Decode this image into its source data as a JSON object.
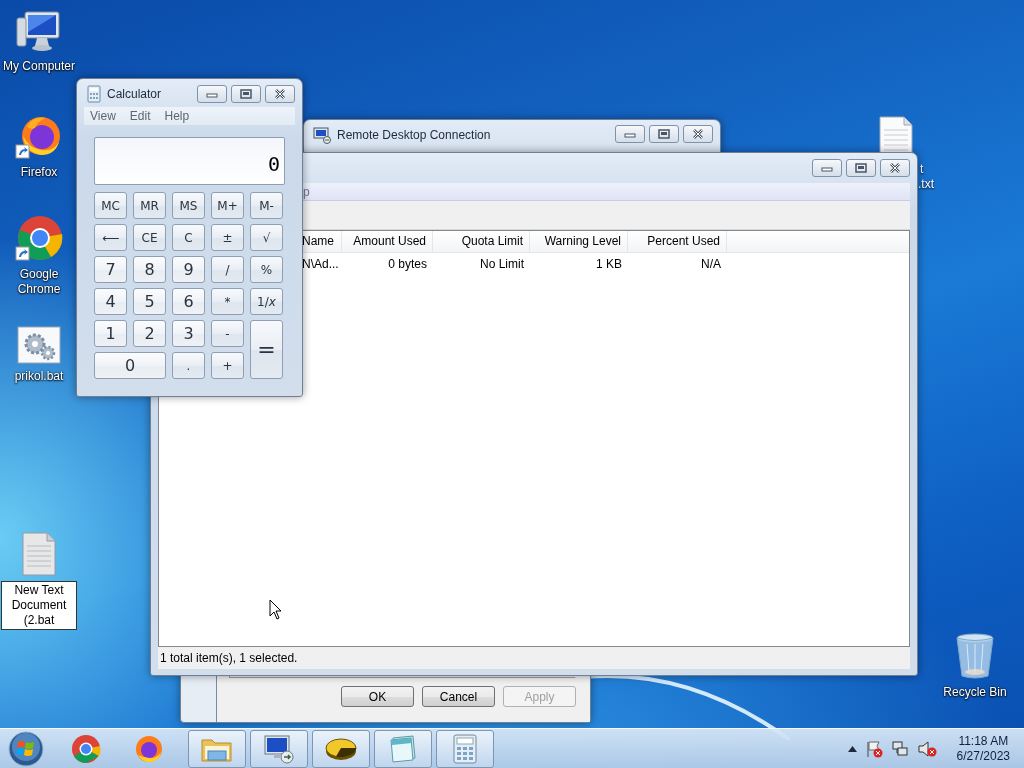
{
  "desktop_icons": [
    {
      "label": "My Computer",
      "kind": "computer",
      "selected": false
    },
    {
      "label": "Firefox",
      "kind": "firefox",
      "selected": false
    },
    {
      "label": "Google Chrome",
      "kind": "chrome",
      "selected": false
    },
    {
      "label": "prikol.bat",
      "kind": "batch",
      "selected": false
    },
    {
      "label": "New Text Document (2.bat",
      "kind": "text",
      "selected": true
    },
    {
      "lines": [
        "t",
        ".txt"
      ],
      "kind": "text"
    },
    {
      "label": "Recycle Bin",
      "kind": "recycle",
      "selected": false
    }
  ],
  "properties_dialog": {
    "buttons": [
      {
        "label": "OK",
        "disabled": false
      },
      {
        "label": "Cancel",
        "disabled": false
      },
      {
        "label": "Apply",
        "disabled": true
      }
    ]
  },
  "remote_desktop_window": {
    "title": "Remote Desktop Connection"
  },
  "quota_window": {
    "menu": [
      "p"
    ],
    "columns": [
      "Name",
      "Amount Used",
      "Quota Limit",
      "Warning Level",
      "Percent Used"
    ],
    "rows": [
      {
        "cells": [
          "N\\Ad...",
          "0 bytes",
          "No Limit",
          "1 KB",
          "N/A"
        ]
      }
    ],
    "status_bar": "1 total item(s), 1 selected."
  },
  "calculator": {
    "title": "Calculator",
    "menu": [
      "View",
      "Edit",
      "Help"
    ],
    "display": "0",
    "keys": [
      {
        "label": "MC",
        "kind": "normal"
      },
      {
        "label": "MR",
        "kind": "normal"
      },
      {
        "label": "MS",
        "kind": "normal"
      },
      {
        "label": "M+",
        "kind": "normal"
      },
      {
        "label": "M-",
        "kind": "normal"
      },
      {
        "label": "⟵",
        "kind": "normal"
      },
      {
        "label": "CE",
        "kind": "normal"
      },
      {
        "label": "C",
        "kind": "normal"
      },
      {
        "label": "±",
        "kind": "normal"
      },
      {
        "label": "√",
        "kind": "normal"
      },
      {
        "label": "7",
        "kind": "normal"
      },
      {
        "label": "8",
        "kind": "normal"
      },
      {
        "label": "9",
        "kind": "normal"
      },
      {
        "label": "/",
        "kind": "normal"
      },
      {
        "label": "%",
        "kind": "normal"
      },
      {
        "label": "4",
        "kind": "normal"
      },
      {
        "label": "5",
        "kind": "normal"
      },
      {
        "label": "6",
        "kind": "normal"
      },
      {
        "label": "*",
        "kind": "normal"
      },
      {
        "label": "1/*x*",
        "kind": "normal"
      },
      {
        "label": "1",
        "kind": "normal"
      },
      {
        "label": "2",
        "kind": "normal"
      },
      {
        "label": "3",
        "kind": "normal"
      },
      {
        "label": "-",
        "kind": "normal"
      },
      {
        "label": "=",
        "kind": "tall"
      },
      {
        "label": "0",
        "kind": "wide"
      },
      {
        "label": ".",
        "kind": "normal"
      },
      {
        "label": "+",
        "kind": "normal"
      }
    ]
  },
  "taskbar": {
    "apps": [
      {
        "kind": "chrome",
        "running": false
      },
      {
        "kind": "firefox",
        "running": false
      },
      {
        "kind": "explorer",
        "running": true
      },
      {
        "kind": "remote-desktop",
        "running": true
      },
      {
        "kind": "disk",
        "running": true
      },
      {
        "kind": "notepad",
        "running": true
      },
      {
        "kind": "calculator",
        "running": true
      }
    ],
    "clock_time": "11:18 AM",
    "clock_date": "6/27/2023"
  }
}
